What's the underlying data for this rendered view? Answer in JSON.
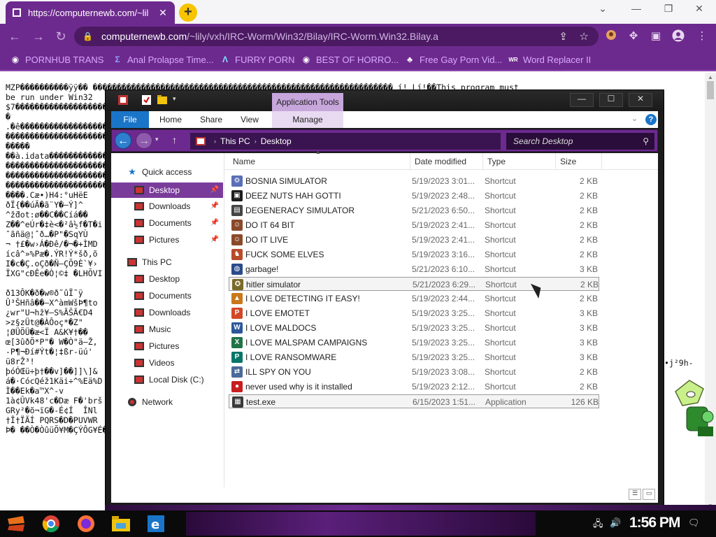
{
  "browser": {
    "tab_title": "https://computernewb.com/~lil",
    "url_domain": "computernewb.com",
    "url_path": "/~lily/vxh/IRC-Worm/Win32/Bilay/IRC-Worm.Win32.Bilay.a",
    "bookmarks": [
      "PORNHUB TRANS",
      "Anal Prolapse Time...",
      "FURRY PORN",
      "BEST OF HORRO...",
      "Free Gay Porn Vid...",
      "Word Replacer II"
    ],
    "accent_color": "#6d2a8e"
  },
  "page": {
    "lines": [
      "MZP����������ÿÿ�� �������������������������������������������������������������� í!¸Lí!��This program must",
      "be run under Win32  ",
      "$7��������������������������������������������������������������������������������������������������à����",
      "�",
      ".�ê�������������������������������������������������������������������������������������������������`��",
      "����������������������������������������������������������������������������������������������������",
      "�����",
      "��à.idata����������������������������������������������������������������������������������������",
      "����������������������������������������������������������������������������������������������������",
      "����������������������������������������������������������������������������������������������������",
      "����������������������������������������������������������������������������������������������������",
      "����.Cæ•)H4:°uHëE",
      "ðÏ{��úÄ�ã¨Y�–Ý]^",
      "^ž̆dot:ø��C��Cíá��",
      "Z��^eÚr�‡è<�²â½f�T�i",
      "ˆãñä@¦ˆð…�P\"�SqYÙ",
      "¬ †£�w›Á�Ðê/�¬�+ÌMD",
      "ícâ^»%Pæ�.ÝR!Ý*šð,õ",
      "I�c�Ç.oÇð�Ñ–ÇÕ9È`¥›",
      "ÏXG\"cÐÊe�Ò¦©‡ �LHÕVI",
      "",
      "ð13ÔK�ð�w®ð˜ûÏ˜ÿ",
      "Û³ŠHñâ��–X^àmWšÞ¶to",
      "¿wr\"U¬hž¥—S%ÃŠÃ€D4",
      ">z§zÜt@�ÀÔoç*�Z\"",
      "¦ØÜÕÜ�æ<Ï A&K¥†��",
      "œ[3ûðÕ*P\"� W�Ò\"ä–Ž,",
      "-P¶¬Ðí#Ýt�¦‡ßr-üú'",
      "ü8rŽ³!",
      "þóÓŒü÷þ†��v]��]]\\]&",
      "á�·CócQéž1Käi÷^%Eä%D",
      "Ì��Ek�a™X^-v",
      "1à¢ÛVk48'c�Dæ F�'brš",
      "GRy²�õ¬ïG�-É¢Í  ÎNl",
      "†Î†ÏÃÍ PQRS�D�PUVWR",
      "Þ� ��Ò�ÒûüÕ¥M�ÇÝÔG¥É�"
    ],
    "right_fragment": "•j²9h-"
  },
  "explorer": {
    "app_tools_label": "Application Tools",
    "window_title": "Desktop",
    "ribbon_tabs": [
      "File",
      "Home",
      "Share",
      "View",
      "Manage"
    ],
    "path": [
      "This PC",
      "Desktop"
    ],
    "search_placeholder": "Search Desktop",
    "nav": {
      "quick_access": "Quick access",
      "quick_items": [
        "Desktop",
        "Downloads",
        "Documents",
        "Pictures"
      ],
      "this_pc": "This PC",
      "pc_items": [
        "Desktop",
        "Documents",
        "Downloads",
        "Music",
        "Pictures",
        "Videos",
        "Local Disk (C:)"
      ],
      "network": "Network"
    },
    "columns": [
      "Name",
      "Date modified",
      "Type",
      "Size"
    ],
    "files": [
      {
        "name": "BOSNIA SIMULATOR",
        "date": "5/19/2023 3:01...",
        "type": "Shortcut",
        "size": "2 KB",
        "icon": "gear-icon",
        "color": "#5a6fb8"
      },
      {
        "name": "DEEZ NUTS HAH GOTTI",
        "date": "5/19/2023 2:48...",
        "type": "Shortcut",
        "size": "2 KB",
        "icon": "console-icon",
        "color": "#1c1c1c"
      },
      {
        "name": "DEGENERACY SIMULATOR",
        "date": "5/21/2023 6:50...",
        "type": "Shortcut",
        "size": "2 KB",
        "icon": "document-icon",
        "color": "#444444"
      },
      {
        "name": "DO IT 64 BIT",
        "date": "5/19/2023 2:41...",
        "type": "Shortcut",
        "size": "2 KB",
        "icon": "face-icon",
        "color": "#8a4a2a"
      },
      {
        "name": "DO IT LIVE",
        "date": "5/19/2023 2:41...",
        "type": "Shortcut",
        "size": "2 KB",
        "icon": "face-icon",
        "color": "#8a4a2a"
      },
      {
        "name": "FUCK SOME ELVES",
        "date": "5/19/2023 3:16...",
        "type": "Shortcut",
        "size": "2 KB",
        "icon": "figure-icon",
        "color": "#b84a2a"
      },
      {
        "name": "garbage!",
        "date": "5/21/2023 6:10...",
        "type": "Shortcut",
        "size": "3 KB",
        "icon": "globe-icon",
        "color": "#2a4a8a"
      },
      {
        "name": "hitler simulator",
        "date": "5/21/2023 6:29...",
        "type": "Shortcut",
        "size": "2 KB",
        "icon": "badge-icon",
        "color": "#7a6a2a"
      },
      {
        "name": "I LOVE DETECTING IT EASY!",
        "date": "5/19/2023 2:44...",
        "type": "Shortcut",
        "size": "2 KB",
        "icon": "app-icon",
        "color": "#c8781a"
      },
      {
        "name": "I LOVE EMOTET",
        "date": "5/19/2023 3:25...",
        "type": "Shortcut",
        "size": "3 KB",
        "icon": "powerpoint-icon",
        "color": "#d24726"
      },
      {
        "name": "I LOVE MALDOCS",
        "date": "5/19/2023 3:25...",
        "type": "Shortcut",
        "size": "3 KB",
        "icon": "word-icon",
        "color": "#2b579a"
      },
      {
        "name": "I LOVE MALSPAM CAMPAIGNS",
        "date": "5/19/2023 3:25...",
        "type": "Shortcut",
        "size": "3 KB",
        "icon": "excel-icon",
        "color": "#217346"
      },
      {
        "name": "I LOVE RANSOMWARE",
        "date": "5/19/2023 3:25...",
        "type": "Shortcut",
        "size": "3 KB",
        "icon": "publisher-icon",
        "color": "#077568"
      },
      {
        "name": "ILL SPY ON YOU",
        "date": "5/19/2023 3:08...",
        "type": "Shortcut",
        "size": "2 KB",
        "icon": "network-icon",
        "color": "#4a6a9a"
      },
      {
        "name": "never used why is it installed",
        "date": "5/19/2023 2:12...",
        "type": "Shortcut",
        "size": "2 KB",
        "icon": "stop-icon",
        "color": "#c81e1e"
      },
      {
        "name": "test.exe",
        "date": "6/15/2023 1:51...",
        "type": "Application",
        "size": "126 KB",
        "icon": "exe-icon",
        "color": "#3a3a3a"
      }
    ],
    "selected_rows": [
      7,
      15
    ]
  },
  "taskbar": {
    "clock": "1:56 PM"
  }
}
